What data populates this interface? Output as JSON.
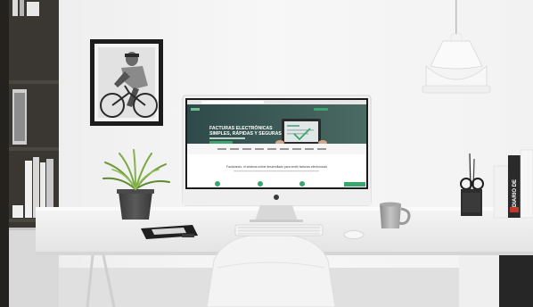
{
  "scene": {
    "screen": {
      "hero_title_line1": "FACTURAS ELECTRÓNICAS",
      "hero_title_line2": "SIMPLES, RÁPIDAS Y SEGURAS.",
      "tagline": "Facturando, el sistema online desarrollado para emitir facturas electrónicas",
      "logo_text": "facturando"
    },
    "book_spine_text": "DIARIO DE"
  }
}
